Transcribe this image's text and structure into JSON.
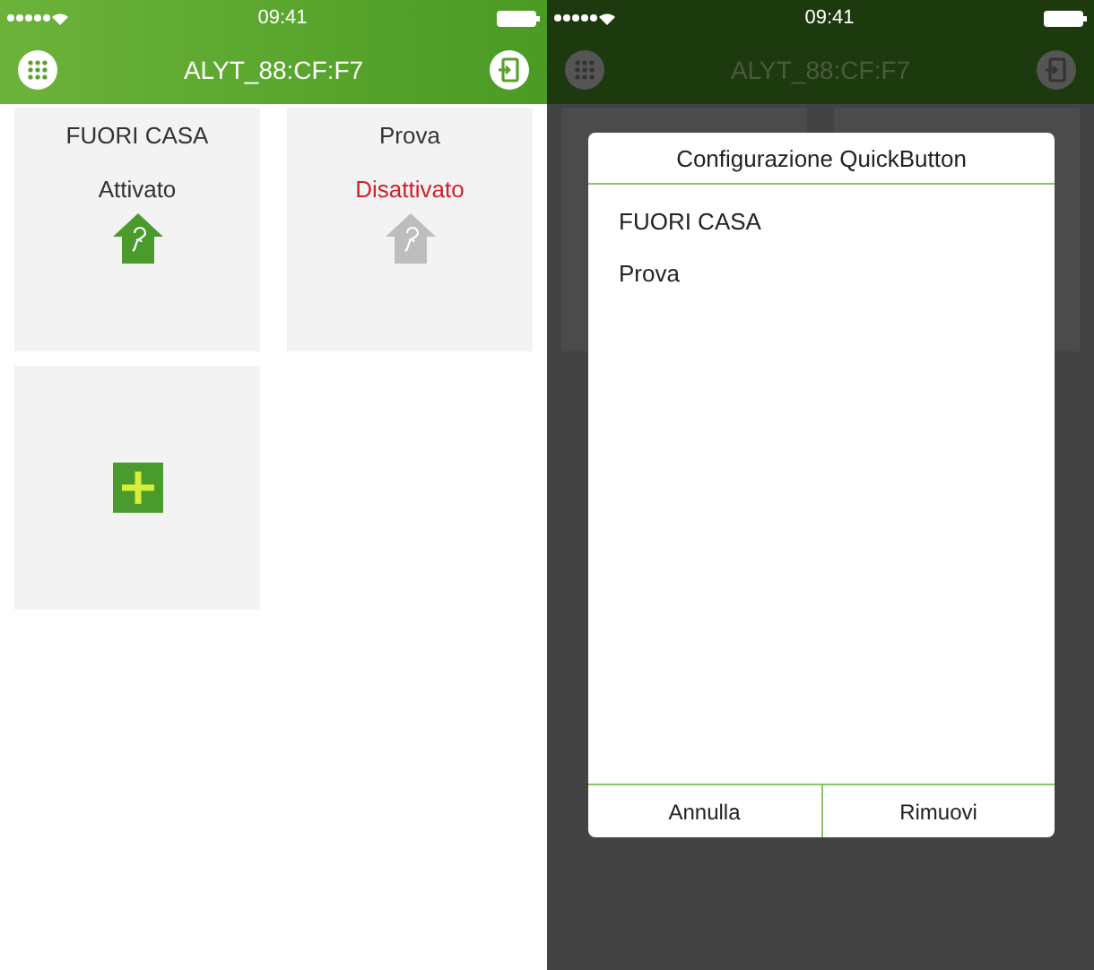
{
  "home": {
    "status_bar": {
      "time": "09:41"
    },
    "title": "ALYT_88:CF:F7",
    "tiles": [
      {
        "kind": "scenario",
        "name": "FUORI CASA",
        "status": "Attivato",
        "active": true
      },
      {
        "kind": "scenario",
        "name": "Prova",
        "status": "Disattivato",
        "active": false
      },
      {
        "kind": "add"
      }
    ]
  },
  "config_screen": {
    "status_bar": {
      "time": "09:41"
    },
    "title": "ALYT_88:CF:F7",
    "dialog": {
      "title": "Configurazione QuickButton",
      "items": [
        "FUORI CASA",
        "Prova"
      ],
      "buttons": [
        "Annulla",
        "Rimuovi"
      ]
    }
  }
}
